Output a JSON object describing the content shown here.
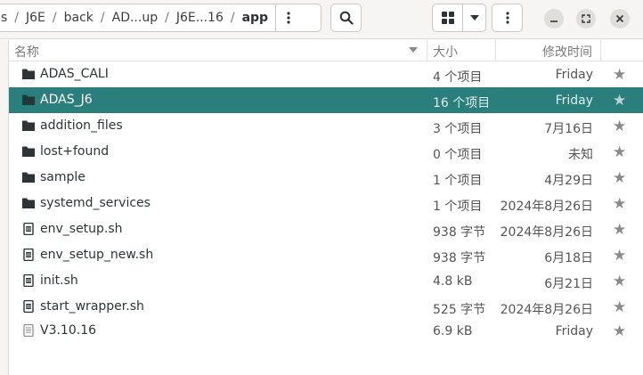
{
  "pathbar": {
    "crumbs": [
      "s",
      "J6E",
      "back",
      "AD...up",
      "J6E...16",
      "app"
    ],
    "separator": "/"
  },
  "columns": {
    "name": "名称",
    "size": "大小",
    "modified": "修改时间"
  },
  "files": [
    {
      "type": "folder",
      "name": "ADAS_CALI",
      "size": "4 个项目",
      "modified": "Friday",
      "selected": false
    },
    {
      "type": "folder",
      "name": "ADAS_J6",
      "size": "16 个项目",
      "modified": "Friday",
      "selected": true
    },
    {
      "type": "folder",
      "name": "addition_files",
      "size": "3 个项目",
      "modified": "7月16日",
      "selected": false
    },
    {
      "type": "folder",
      "name": "lost+found",
      "size": "0 个项目",
      "modified": "未知",
      "selected": false
    },
    {
      "type": "folder",
      "name": "sample",
      "size": "1 个项目",
      "modified": "4月29日",
      "selected": false
    },
    {
      "type": "folder",
      "name": "systemd_services",
      "size": "1 个项目",
      "modified": "2024年8月26日",
      "selected": false
    },
    {
      "type": "script",
      "name": "env_setup.sh",
      "size": "938 字节",
      "modified": "2024年8月26日",
      "selected": false
    },
    {
      "type": "script",
      "name": "env_setup_new.sh",
      "size": "938 字节",
      "modified": "6月18日",
      "selected": false
    },
    {
      "type": "script",
      "name": "init.sh",
      "size": "4.8 kB",
      "modified": "6月21日",
      "selected": false
    },
    {
      "type": "script",
      "name": "start_wrapper.sh",
      "size": "525 字节",
      "modified": "2024年8月26日",
      "selected": false
    },
    {
      "type": "text",
      "name": "V3.10.16",
      "size": "6.9 kB",
      "modified": "Friday",
      "selected": false
    }
  ],
  "colors": {
    "selection": "#2a7f7c",
    "header_bg": "#f6f5f4"
  }
}
